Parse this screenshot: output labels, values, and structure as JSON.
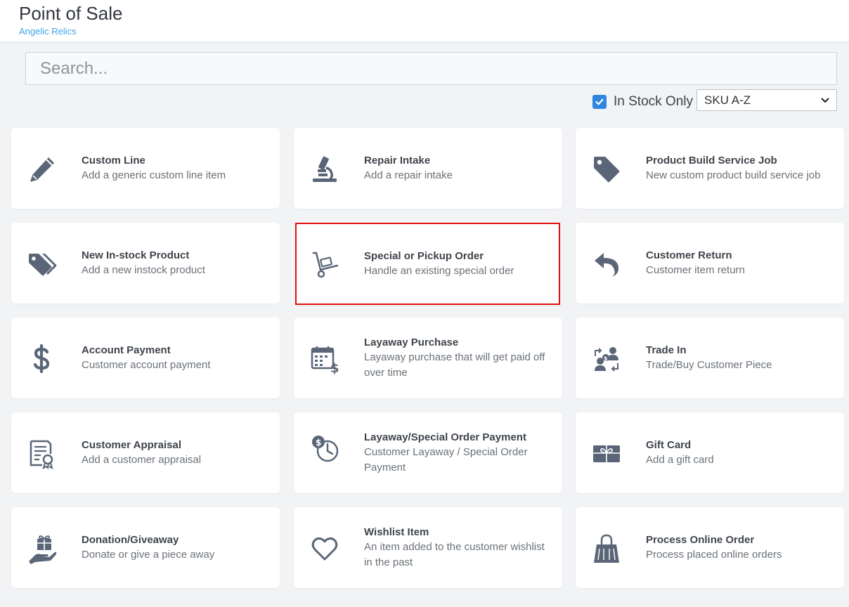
{
  "header": {
    "title": "Point of Sale",
    "subtitle": "Angelic Relics"
  },
  "search": {
    "placeholder": "Search..."
  },
  "filters": {
    "in_stock_label": "In Stock Only",
    "in_stock_checked": true,
    "sort_selected": "SKU A-Z"
  },
  "colors": {
    "accent": "#2f86e0",
    "subtitle": "#3da5e8",
    "icon": "#5a6677",
    "selected_outline": "#e01010"
  },
  "cards": [
    {
      "title": "Custom Line",
      "desc": "Add a generic custom line item",
      "icon": "pencil-icon"
    },
    {
      "title": "Repair Intake",
      "desc": "Add a repair intake",
      "icon": "microscope-icon"
    },
    {
      "title": "Product Build Service Job",
      "desc": "New custom product build service job",
      "icon": "tag-icon"
    },
    {
      "title": "New In-stock Product",
      "desc": "Add a new instock product",
      "icon": "tags-icon"
    },
    {
      "title": "Special or Pickup Order",
      "desc": "Handle an existing special order",
      "icon": "hand-truck-icon",
      "selected": true
    },
    {
      "title": "Customer Return",
      "desc": "Customer item return",
      "icon": "return-arrow-icon"
    },
    {
      "title": "Account Payment",
      "desc": "Customer account payment",
      "icon": "dollar-icon"
    },
    {
      "title": "Layaway Purchase",
      "desc": "Layaway purchase that will get paid off over time",
      "icon": "calendar-dollar-icon"
    },
    {
      "title": "Trade In",
      "desc": "Trade/Buy Customer Piece",
      "icon": "people-exchange-icon"
    },
    {
      "title": "Customer Appraisal",
      "desc": "Add a customer appraisal",
      "icon": "certificate-icon"
    },
    {
      "title": "Layaway/Special Order Payment",
      "desc": "Customer Layaway / Special Order Payment",
      "icon": "clock-dollar-icon"
    },
    {
      "title": "Gift Card",
      "desc": "Add a gift card",
      "icon": "gift-card-icon"
    },
    {
      "title": "Donation/Giveaway",
      "desc": "Donate or give a piece away",
      "icon": "hand-gift-icon"
    },
    {
      "title": "Wishlist Item",
      "desc": "An item added to the customer wishlist in the past",
      "icon": "heart-icon"
    },
    {
      "title": "Process Online Order",
      "desc": "Process placed online orders",
      "icon": "shopping-bag-icon"
    }
  ]
}
